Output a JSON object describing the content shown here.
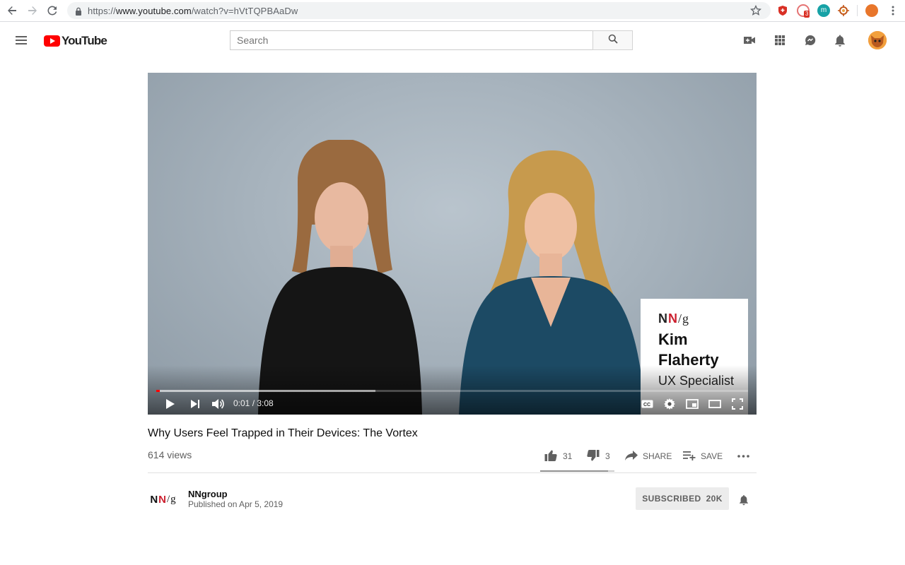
{
  "browser": {
    "url_scheme": "https://",
    "url_host": "www.youtube.com",
    "url_path": "/watch?v=hVtTQPBAaDw",
    "extension_badge": "3",
    "extension_letter": "m"
  },
  "header": {
    "logo_text": "YouTube",
    "search_placeholder": "Search"
  },
  "player": {
    "time": "0:01 / 3:08",
    "played_fraction": 0.006,
    "loaded_fraction": 0.37,
    "lower_third": {
      "brand_n1": "N",
      "brand_n2": "N",
      "brand_slash": "/g",
      "name_line1": "Kim",
      "name_line2": "Flaherty",
      "role": "UX Specialist"
    }
  },
  "video": {
    "title": "Why Users Feel Trapped in Their Devices: The Vortex",
    "views": "614 views",
    "likes": "31",
    "dislikes": "3",
    "like_ratio": 0.91,
    "share_label": "SHARE",
    "save_label": "SAVE"
  },
  "channel": {
    "logo_n1": "N",
    "logo_n2": "N",
    "logo_slash": "/g",
    "name": "NNgroup",
    "published": "Published on Apr 5, 2019",
    "subscribe_label": "SUBSCRIBED",
    "subscriber_count": "20K"
  },
  "colors": {
    "brand_red": "#ff0000",
    "nn_red": "#cc1f2e"
  }
}
